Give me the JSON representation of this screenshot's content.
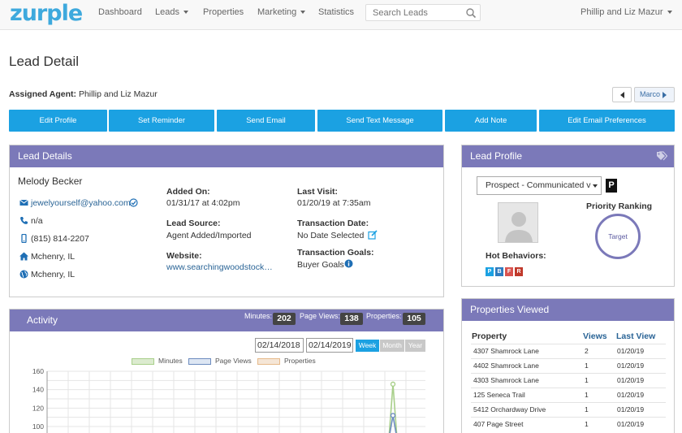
{
  "app": {
    "logo": "zurple"
  },
  "nav": {
    "items": [
      {
        "label": "Dashboard"
      },
      {
        "label": "Leads"
      },
      {
        "label": "Properties"
      },
      {
        "label": "Marketing"
      },
      {
        "label": "Statistics"
      }
    ],
    "search_placeholder": "Search Leads",
    "user_name": "Phillip and Liz Mazur"
  },
  "page": {
    "title": "Lead Detail",
    "assigned_label": "Assigned Agent:",
    "assigned_value": "Phillip and Liz Mazur",
    "next_lead": "Marco"
  },
  "actions": [
    {
      "label": "Edit Profile"
    },
    {
      "label": "Set Reminder"
    },
    {
      "label": "Send Email"
    },
    {
      "label": "Send Text Message"
    },
    {
      "label": "Add Note"
    },
    {
      "label": "Edit Email Preferences"
    }
  ],
  "lead_details": {
    "title": "Lead Details",
    "name": "Melody Becker",
    "email": "jewelyourself@yahoo.com",
    "phone_home": "n/a",
    "phone_mobile": "(815) 814-2207",
    "home_city": "Mchenry, IL",
    "search_city": "Mchenry, IL",
    "added_on_label": "Added On:",
    "added_on_value": "01/31/17 at 4:02pm",
    "lead_source_label": "Lead Source:",
    "lead_source_value": "Agent Added/Imported",
    "website_label": "Website:",
    "website_value": "www.searchingwoodstock…",
    "last_visit_label": "Last Visit:",
    "last_visit_value": "01/20/19 at 7:35am",
    "transaction_date_label": "Transaction Date:",
    "transaction_date_value": "No Date Selected",
    "transaction_goals_label": "Transaction Goals:",
    "transaction_goals_value": "Buyer Goals"
  },
  "lead_profile": {
    "title": "Lead Profile",
    "status_selected": "Prospect - Communicated v",
    "badge": "P",
    "hot_behaviors_label": "Hot Behaviors:",
    "behaviors": [
      {
        "letter": "P",
        "color": "#1ba1e2"
      },
      {
        "letter": "B",
        "color": "#2e7bbf"
      },
      {
        "letter": "F",
        "color": "#d9534f"
      },
      {
        "letter": "R",
        "color": "#c0392b"
      }
    ],
    "priority_label": "Priority Ranking",
    "priority_value": "Target"
  },
  "activity": {
    "title": "Activity",
    "minutes_label": "Minutes:",
    "minutes_value": "202",
    "pageviews_label": "Page Views:",
    "pageviews_value": "138",
    "properties_label": "Properties:",
    "properties_value": "105",
    "date_from": "02/14/2018",
    "date_to": "02/14/2019",
    "ranges": [
      {
        "label": "Week"
      },
      {
        "label": "Month"
      },
      {
        "label": "Year"
      }
    ]
  },
  "chart_data": {
    "type": "line",
    "series": [
      {
        "name": "Minutes",
        "color": "#a8cf8a",
        "peak": 146
      },
      {
        "name": "Page Views",
        "color": "#6d8cbf",
        "peak": 112
      },
      {
        "name": "Properties",
        "color": "#e6b98a",
        "peak": 0
      }
    ],
    "y_ticks": [
      "160",
      "140",
      "120",
      "100"
    ],
    "ylim": [
      100,
      160
    ],
    "grid": true,
    "legend": "top"
  },
  "properties_viewed": {
    "title": "Properties Viewed",
    "col_property": "Property",
    "col_views": "Views",
    "col_last_view": "Last View",
    "rows": [
      {
        "property": "4307 Shamrock Lane",
        "views": "2",
        "last": "01/20/19"
      },
      {
        "property": "4402 Shamrock Lane",
        "views": "1",
        "last": "01/20/19"
      },
      {
        "property": "4303 Shamrock Lane",
        "views": "1",
        "last": "01/20/19"
      },
      {
        "property": "125 Seneca Trail",
        "views": "1",
        "last": "01/20/19"
      },
      {
        "property": "5412 Orchardway Drive",
        "views": "1",
        "last": "01/20/19"
      },
      {
        "property": "407 Page Street",
        "views": "1",
        "last": "01/20/19"
      }
    ]
  }
}
